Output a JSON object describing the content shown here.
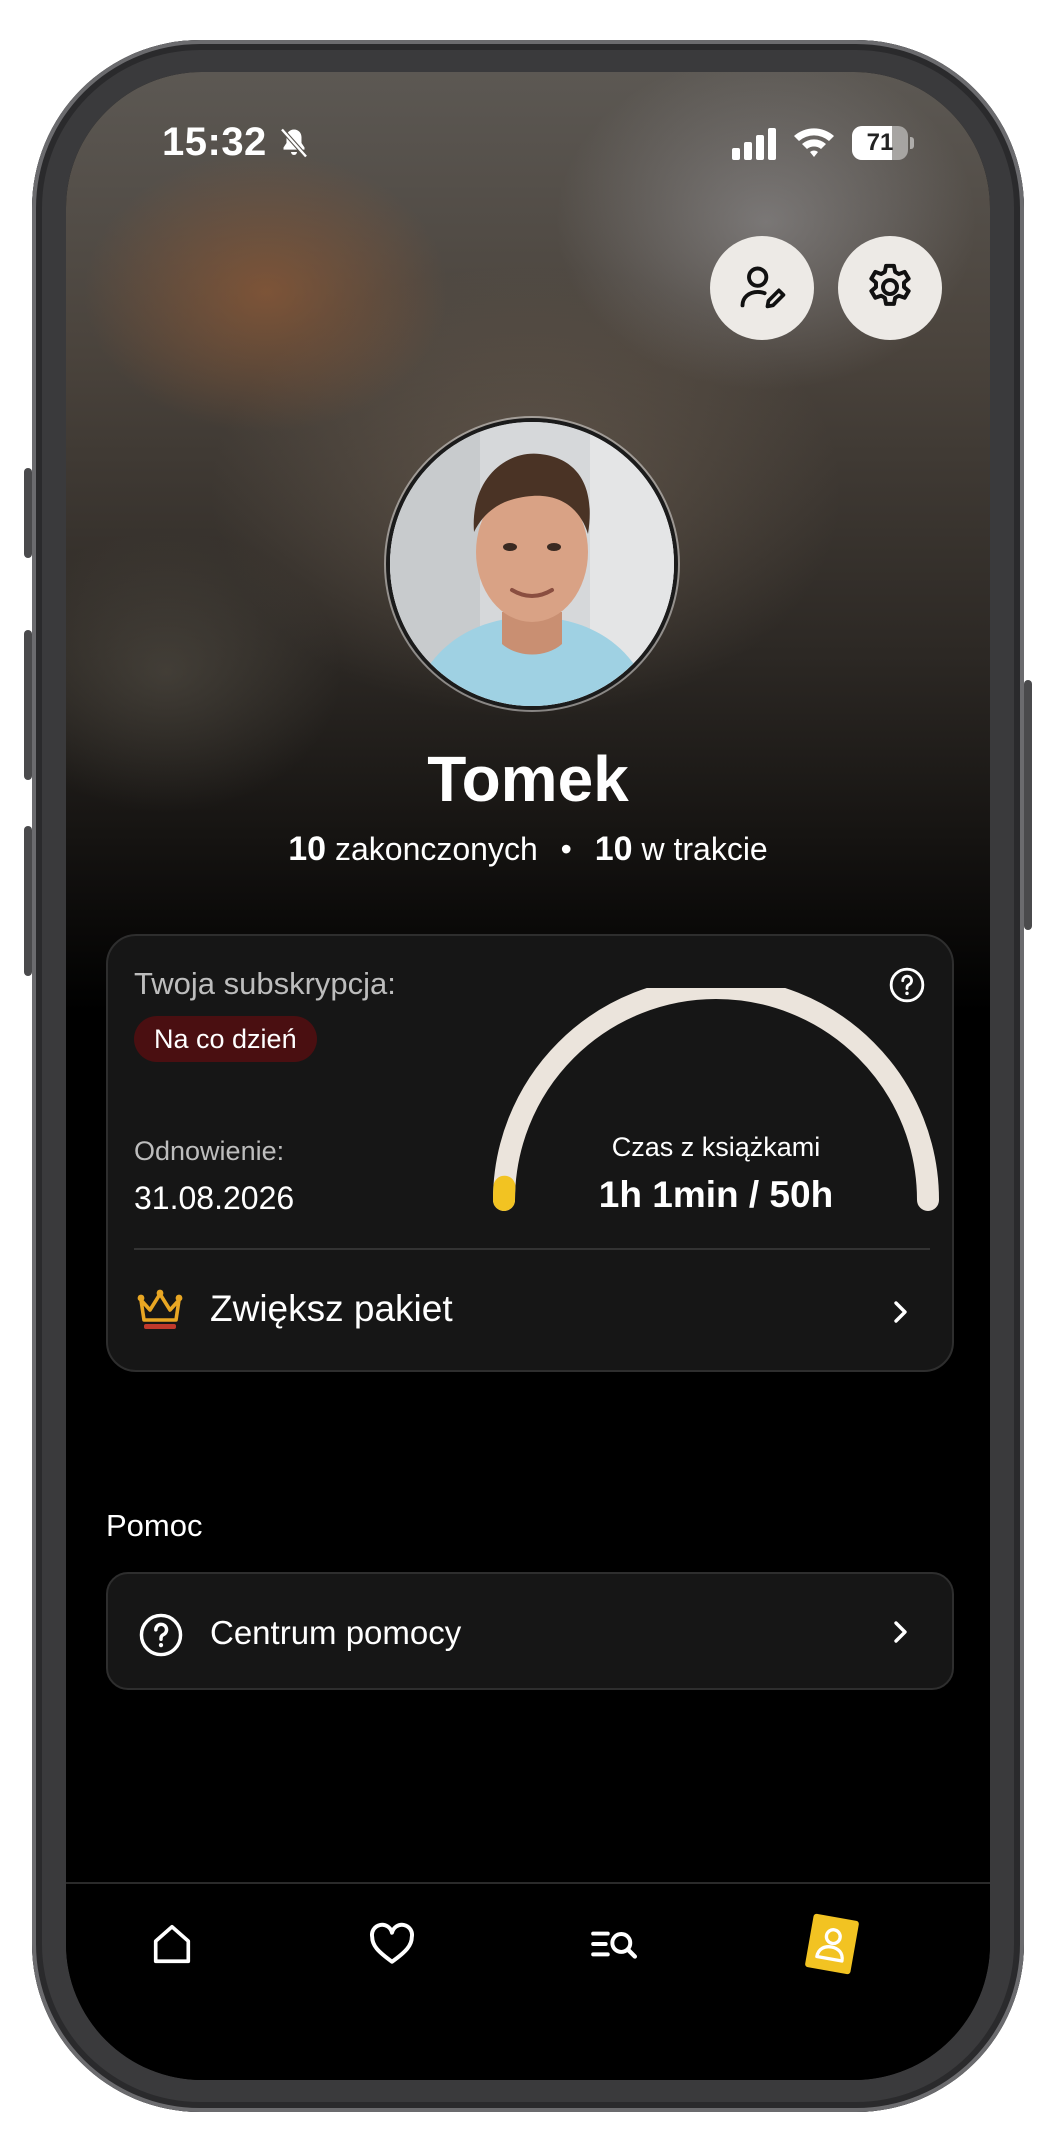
{
  "status_bar": {
    "time": "15:32",
    "battery_percent": "71",
    "battery_level": 0.71
  },
  "header": {
    "edit_profile_icon": "user-edit-icon",
    "settings_icon": "gear-icon"
  },
  "profile": {
    "name": "Tomek",
    "finished_count": "10",
    "finished_label": "zakonczonych",
    "separator": "•",
    "in_progress_count": "10",
    "in_progress_label": "w trakcie"
  },
  "subscription": {
    "label": "Twoja subskrypcja:",
    "plan": "Na co dzień",
    "renewal_label": "Odnowienie:",
    "renewal_date": "31.08.2026",
    "time_label": "Czas z książkami",
    "time_value": "1h 1min / 50h",
    "usage_fraction": 0.02,
    "upgrade_label": "Zwiększ pakiet"
  },
  "help_section": {
    "title": "Pomoc",
    "help_center_label": "Centrum pomocy"
  },
  "tab_bar": {
    "tabs": [
      {
        "icon": "home-icon",
        "active": false
      },
      {
        "icon": "heart-icon",
        "active": false
      },
      {
        "icon": "list-search-icon",
        "active": false
      },
      {
        "icon": "profile-icon",
        "active": true
      }
    ]
  },
  "colors": {
    "accent": "#f2c322",
    "badge_bg": "#4a0f11",
    "card_bg": "#161616",
    "gauge_track": "#ebe4dc"
  }
}
